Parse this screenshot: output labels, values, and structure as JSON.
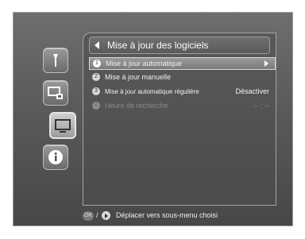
{
  "panel": {
    "title": "Mise à jour des logiciels"
  },
  "menu": {
    "items": [
      {
        "number": "1",
        "label": "Mise à jour automatique",
        "value": "",
        "state": "selected"
      },
      {
        "number": "2",
        "label": "Mise à jour manuelle",
        "value": "",
        "state": "normal"
      },
      {
        "number": "3",
        "label": "Mise à jour automatique régulière",
        "value": "Désactiver",
        "state": "normal"
      },
      {
        "number": "4",
        "label": "Heure de recherche",
        "value": "-- : --",
        "state": "disabled"
      }
    ]
  },
  "help": {
    "ok_key": "OK",
    "separator": "/",
    "text": "Déplacer vers sous-menu choisi"
  },
  "sidebar": {
    "icons": [
      "wrench-icon",
      "network-settings-icon",
      "tv-icon",
      "info-icon"
    ],
    "active_index": 2
  }
}
